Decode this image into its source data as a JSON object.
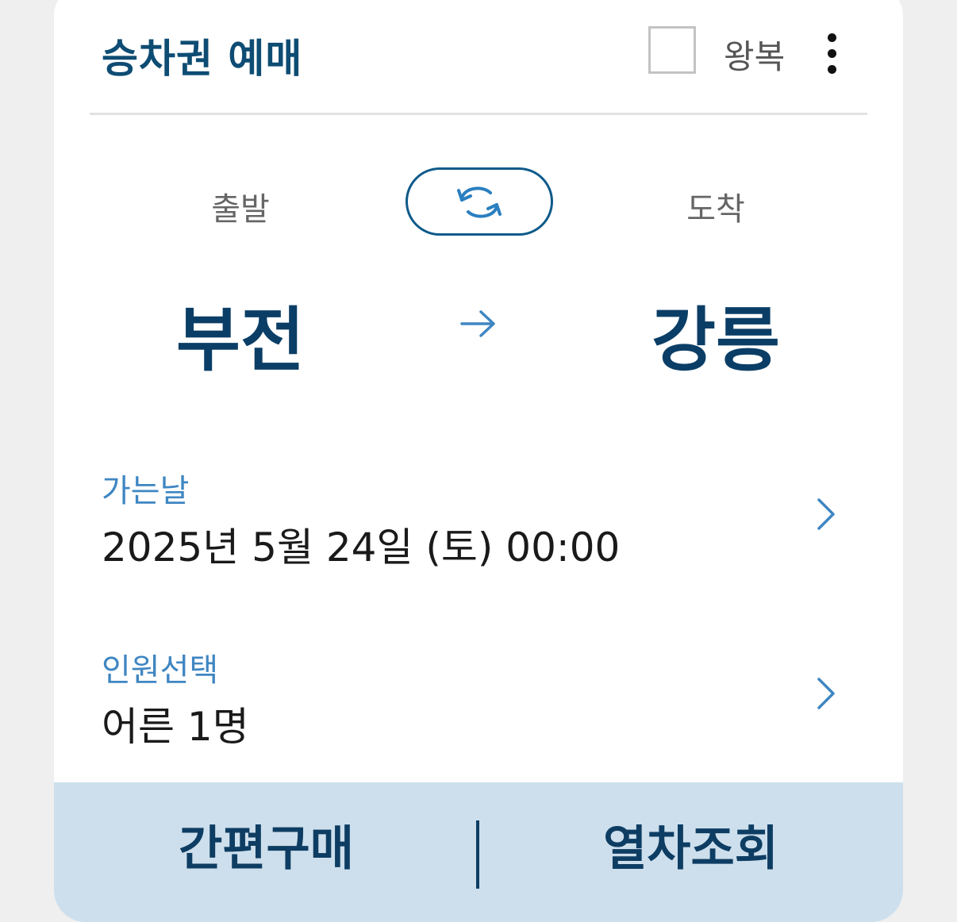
{
  "header": {
    "title": "승차권 예매",
    "roundtrip_label": "왕복",
    "roundtrip_checked": false
  },
  "route": {
    "departure_heading": "출발",
    "arrival_heading": "도착",
    "departure_station": "부전",
    "arrival_station": "강릉"
  },
  "date_field": {
    "label": "가는날",
    "value": "2025년 5월 24일 (토) 00:00"
  },
  "passenger_field": {
    "label": "인원선택",
    "value": "어른 1명"
  },
  "footer": {
    "quick_purchase_label": "간편구매",
    "train_search_label": "열차조회"
  },
  "icons": {
    "more": "more-vertical-icon",
    "swap": "swap-icon",
    "route_arrow": "arrow-right-icon",
    "chevron": "chevron-right-icon"
  },
  "colors": {
    "title": "#0e4c73",
    "station": "#0b3e66",
    "label_accent": "#3f86c2",
    "footer_bg": "#cddfec",
    "footer_text": "#0e3d63"
  }
}
